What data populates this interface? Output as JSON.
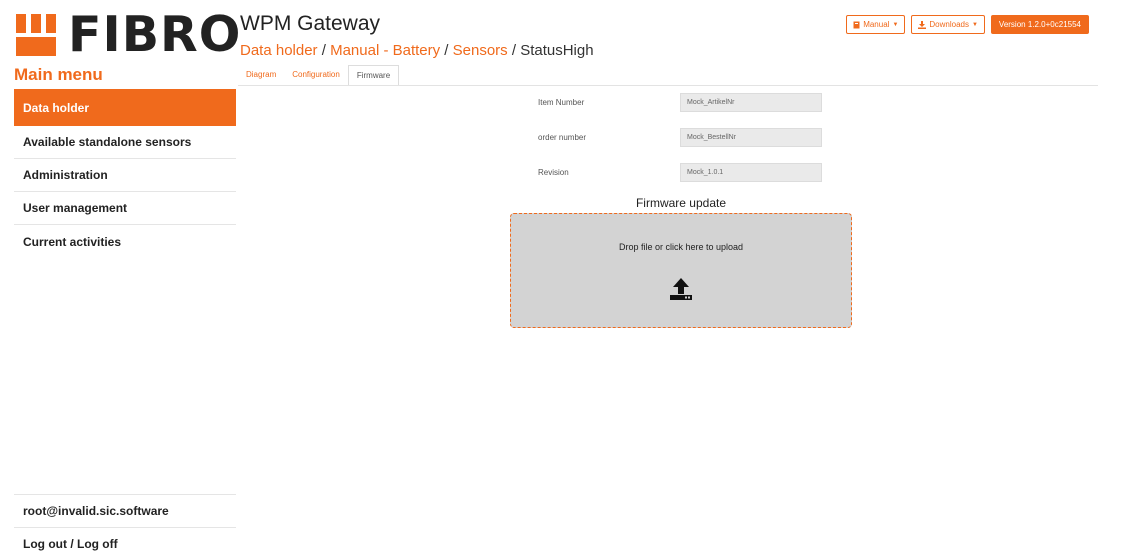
{
  "brand": {
    "logo_text": "FIBRO",
    "accent": "#f06a1c"
  },
  "header": {
    "app_title": "WPM Gateway",
    "breadcrumb": [
      {
        "label": "Data holder",
        "link": true
      },
      {
        "label": "Manual - Battery",
        "link": true
      },
      {
        "label": "Sensors",
        "link": true
      },
      {
        "label": "StatusHigh",
        "link": false
      }
    ],
    "separator": "/"
  },
  "top_buttons": {
    "manual_label": "Manual",
    "downloads_label": "Downloads",
    "version_label": "Version 1.2.0+0c21554"
  },
  "sidebar": {
    "title": "Main menu",
    "items": [
      {
        "label": "Data holder",
        "active": true
      },
      {
        "label": "Available standalone sensors",
        "active": false
      },
      {
        "label": "Administration",
        "active": false
      },
      {
        "label": "User management",
        "active": false
      },
      {
        "label": "Current activities",
        "active": false
      }
    ],
    "user": "root@invalid.sic.software",
    "logout": "Log out / Log off"
  },
  "tabs": [
    {
      "label": "Diagram",
      "active": false
    },
    {
      "label": "Configuration",
      "active": false
    },
    {
      "label": "Firmware",
      "active": true
    }
  ],
  "fields": [
    {
      "label": "Item Number",
      "value": "Mock_ArtikelNr"
    },
    {
      "label": "order number",
      "value": "Mock_BestellNr"
    },
    {
      "label": "Revision",
      "value": "Mock_1.0.1"
    }
  ],
  "firmware": {
    "title": "Firmware update",
    "dropzone_text": "Drop file or click here to upload"
  },
  "icons": {
    "manual": "book-icon",
    "downloads": "download-icon",
    "upload": "upload-icon"
  }
}
